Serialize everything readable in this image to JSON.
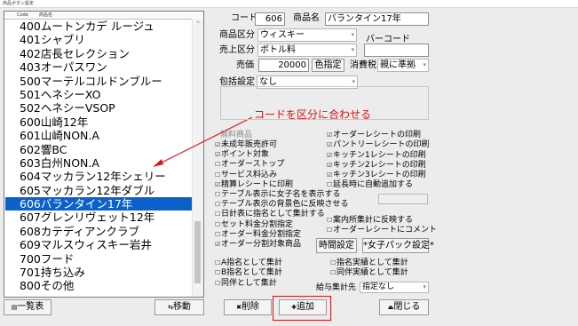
{
  "window": {
    "title": "商品ボタン設定"
  },
  "list": {
    "headers": [
      "Code",
      "商品名"
    ],
    "rows": [
      {
        "code": "400",
        "name": "ムートンカデ ルージュ"
      },
      {
        "code": "401",
        "name": "シャブリ"
      },
      {
        "code": "402",
        "name": "店長セレクション"
      },
      {
        "code": "403",
        "name": "オーパスワン"
      },
      {
        "code": "500",
        "name": "マーテルコルドンブルー"
      },
      {
        "code": "501",
        "name": "ヘネシーXO"
      },
      {
        "code": "502",
        "name": "ヘネシーVSOP"
      },
      {
        "code": "600",
        "name": "山崎12年"
      },
      {
        "code": "601",
        "name": "山崎NON.A"
      },
      {
        "code": "602",
        "name": "響BC"
      },
      {
        "code": "603",
        "name": "白州NON.A"
      },
      {
        "code": "604",
        "name": "マッカラン12年シェリー"
      },
      {
        "code": "605",
        "name": "マッカラン12年ダブル"
      },
      {
        "code": "606",
        "name": "バランタイン17年"
      },
      {
        "code": "607",
        "name": "グレンリヴェット12年"
      },
      {
        "code": "608",
        "name": "カテディアンクラブ"
      },
      {
        "code": "609",
        "name": "マルスウィスキー岩井"
      },
      {
        "code": "700",
        "name": "フード"
      },
      {
        "code": "701",
        "name": "持ち込み"
      },
      {
        "code": "800",
        "name": "その他"
      }
    ],
    "selected_code": "606"
  },
  "form": {
    "code_label": "コード",
    "code_value": "606",
    "name_label": "商品名",
    "name_value": "バランタイン17年",
    "category_label": "商品区分",
    "category_value": "ウィスキー",
    "barcode_label": "バーコード",
    "barcode_value": "",
    "sales_label": "売上区分",
    "sales_value": "ボトル料",
    "price_label": "売価",
    "price_value": "20000",
    "color_button": "色指定",
    "tax_label": "消費税",
    "tax_value": "親に準拠",
    "bundle_label": "包括設定",
    "bundle_value": "なし",
    "free_label": "無料商品",
    "left_checks": [
      {
        "label": "未成年販売許可",
        "checked": true
      },
      {
        "label": "ポイント対象",
        "checked": true
      },
      {
        "label": "オーダーストップ",
        "checked": false
      },
      {
        "label": "サービス料込み",
        "checked": false
      },
      {
        "label": "精算レシートに印刷",
        "checked": true
      },
      {
        "label": "テーブル表示に女子名を表示する",
        "checked": false
      },
      {
        "label": "テーブル表示の背景色に反映させる",
        "checked": false
      },
      {
        "label": "日計表に指名として集計する",
        "checked": false
      },
      {
        "label": "セット料金分割指定",
        "checked": false
      },
      {
        "label": "オーダー料金分割指定",
        "checked": false
      },
      {
        "label": "オーダー分割対象商品",
        "checked": true
      }
    ],
    "right_checks": [
      {
        "label": "オーダーレシートの印刷",
        "checked": true
      },
      {
        "label": "パントリーレシートの印刷",
        "checked": true
      },
      {
        "label": "キッチン1レシートの印刷",
        "checked": true
      },
      {
        "label": "キッチン2レシートの印刷",
        "checked": true
      },
      {
        "label": "キッチン3レシートの印刷",
        "checked": true
      },
      {
        "label": "延長時に自動追加する",
        "checked": false
      }
    ],
    "right_checks2": [
      {
        "label": "案内所集計に反映する",
        "checked": false
      },
      {
        "label": "オーダーレシートにコメント",
        "checked": false
      }
    ],
    "time_button": "時間設定",
    "girl_pack_button": "*女子パック設定*",
    "bottom_checks_left": [
      {
        "label": "A指名として集計",
        "checked": false
      },
      {
        "label": "B指名として集計",
        "checked": false
      },
      {
        "label": "同伴として集計",
        "checked": false
      }
    ],
    "bottom_checks_right": [
      {
        "label": "指名実績として集計",
        "checked": false
      },
      {
        "label": "同伴実績として集計",
        "checked": false
      }
    ],
    "pay_label": "給与集計先",
    "pay_value": "指定なし"
  },
  "buttons": {
    "list_view": "一覧表",
    "move": "移動",
    "delete": "削除",
    "add": "追加",
    "close": "閉じる"
  },
  "annotation": {
    "text": "コードを区分に合わせる",
    "color": "#e01010"
  }
}
